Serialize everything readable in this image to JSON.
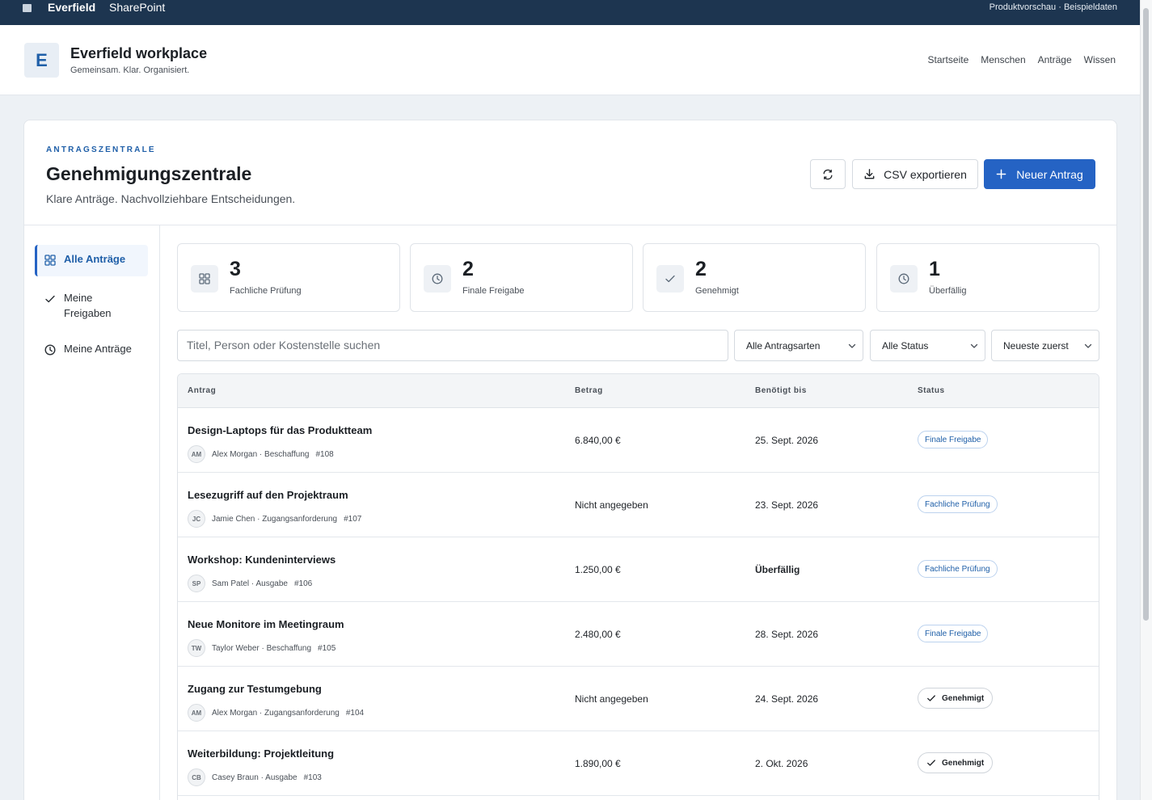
{
  "topbar": {
    "brand": "Everfield",
    "app": "SharePoint",
    "preview": "Produktvorschau · Beispieldaten"
  },
  "site": {
    "logo_letter": "E",
    "title": "Everfield workplace",
    "subtitle": "Gemeinsam. Klar. Organisiert.",
    "nav": [
      "Startseite",
      "Menschen",
      "Anträge",
      "Wissen"
    ]
  },
  "page": {
    "eyebrow": "ANTRAGSZENTRALE",
    "title": "Genehmigungszentrale",
    "subtitle": "Klare Anträge. Nachvollziehbare Entscheidungen.",
    "csv_label": "CSV exportieren",
    "new_label": "Neuer Antrag"
  },
  "sidebar": {
    "items": [
      {
        "label": "Alle Anträge",
        "icon": "grid-icon"
      },
      {
        "label": "Meine Freigaben",
        "icon": "check-icon"
      },
      {
        "label": "Meine Anträge",
        "icon": "clock-icon"
      }
    ]
  },
  "stats": [
    {
      "value": "3",
      "label": "Fachliche Prüfung",
      "icon": "grid-icon"
    },
    {
      "value": "2",
      "label": "Finale Freigabe",
      "icon": "clock-icon"
    },
    {
      "value": "2",
      "label": "Genehmigt",
      "icon": "check-icon"
    },
    {
      "value": "1",
      "label": "Überfällig",
      "icon": "clock-icon"
    }
  ],
  "filters": {
    "search_placeholder": "Titel, Person oder Kostenstelle suchen",
    "type": "Alle Antragsarten",
    "status": "Alle Status",
    "sort": "Neueste zuerst"
  },
  "table": {
    "headers": [
      "Antrag",
      "Betrag",
      "Benötigt bis",
      "Status"
    ],
    "rows": [
      {
        "title": "Design-Laptops für das Produktteam",
        "initials": "AM",
        "meta": "Alex Morgan · Beschaffung",
        "id": "#108",
        "amount": "6.840,00 €",
        "due": "25. Sept. 2026",
        "status": "Finale Freigabe"
      },
      {
        "title": "Lesezugriff auf den Projektraum",
        "initials": "JC",
        "meta": "Jamie Chen · Zugangsanforderung",
        "id": "#107",
        "amount": "Nicht angegeben",
        "due": "23. Sept. 2026",
        "status": "Fachliche Prüfung"
      },
      {
        "title": "Workshop: Kundeninterviews",
        "initials": "SP",
        "meta": "Sam Patel · Ausgabe",
        "id": "#106",
        "amount": "1.250,00 €",
        "due": "Überfällig",
        "status": "Fachliche Prüfung"
      },
      {
        "title": "Neue Monitore im Meetingraum",
        "initials": "TW",
        "meta": "Taylor Weber · Beschaffung",
        "id": "#105",
        "amount": "2.480,00 €",
        "due": "28. Sept. 2026",
        "status": "Finale Freigabe"
      },
      {
        "title": "Zugang zur Testumgebung",
        "initials": "AM",
        "meta": "Alex Morgan · Zugangsanforderung",
        "id": "#104",
        "amount": "Nicht angegeben",
        "due": "24. Sept. 2026",
        "status": "Genehmigt"
      },
      {
        "title": "Weiterbildung: Projektleitung",
        "initials": "CB",
        "meta": "Casey Braun · Ausgabe",
        "id": "#103",
        "amount": "1.890,00 €",
        "due": "2. Okt. 2026",
        "status": "Genehmigt"
      }
    ]
  },
  "colors": {
    "topbar": "#1d3550",
    "accent": "#2563c4",
    "badge_blue": "#1f5fa8"
  }
}
